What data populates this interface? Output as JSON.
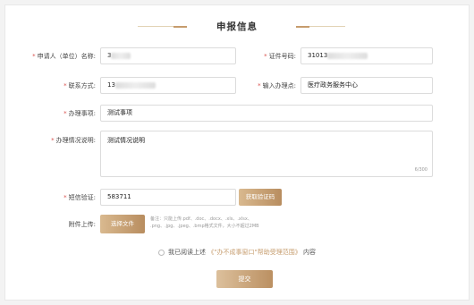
{
  "header": {
    "title": "申报信息"
  },
  "form": {
    "applicant_name": {
      "label": "申请人（单位）名称:",
      "value": "3"
    },
    "id_number": {
      "label": "证件号码:",
      "value": "31013"
    },
    "contact": {
      "label": "联系方式:",
      "value": "13"
    },
    "office": {
      "label": "输入办理点:",
      "value": "医疗政务服务中心"
    },
    "matter": {
      "label": "办理事项:",
      "value": "测试事项"
    },
    "description": {
      "label": "办理情况说明:",
      "value": "测试情况说明",
      "counter": "6/300"
    },
    "sms": {
      "label": "短信验证:",
      "value": "583711",
      "button": "获取验证码"
    },
    "attachment": {
      "label": "附件上传:",
      "button": "选择文件",
      "note_line1": "备注：只能上传.pdf、.doc、.docx、.xls、.xlsx、",
      "note_line2": ".png、.jpg、.jpeg、.bmp格式文件，大小不超过2MB"
    },
    "agreement": {
      "prefix": "我已阅读上述",
      "link": "《\"办不成事窗口\"帮助受理范围》",
      "suffix": "内容"
    },
    "submit": "提交"
  },
  "colors": {
    "accent": "#c69c6d",
    "required": "#d9534f"
  }
}
